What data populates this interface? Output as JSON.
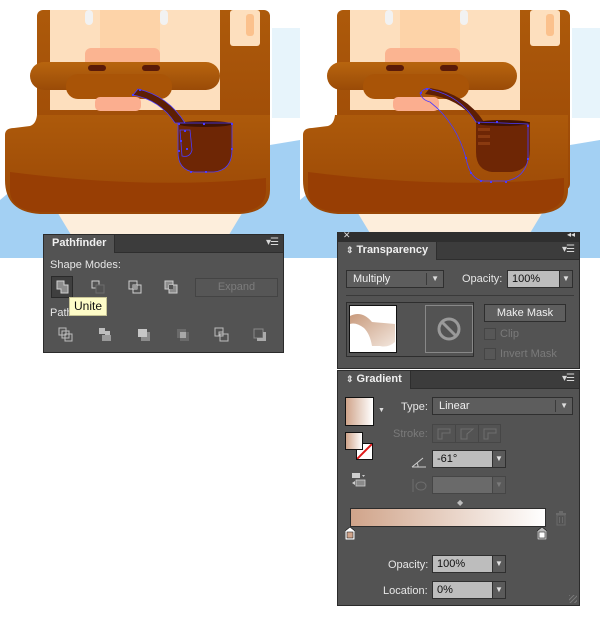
{
  "artwork": {
    "left": {
      "state": "before",
      "description": "pipe selected with anchor points",
      "colors": {
        "beard": "#a65107",
        "beard_dark": "#8c3f05",
        "skin": "#fde0bf",
        "nose": "#fbb08d",
        "pipe": "#6a2204",
        "selection": "#4b3bff",
        "sky": "#a9d3f3"
      }
    },
    "right": {
      "state": "after",
      "description": "pipe with unified shadow path selected"
    }
  },
  "pathfinder": {
    "tab_label": "Pathfinder",
    "menu_icon": "panel-menu-icon",
    "shape_modes_label": "Shape Modes:",
    "shape_modes": [
      {
        "name": "unite",
        "icon": "unite-icon",
        "active": true
      },
      {
        "name": "minus-front",
        "icon": "minus-front-icon"
      },
      {
        "name": "intersect",
        "icon": "intersect-icon"
      },
      {
        "name": "exclude",
        "icon": "exclude-icon"
      }
    ],
    "expand_label": "Expand",
    "pathfinders_label": "Pathfinders:",
    "pathfinders_visible_label": "Path",
    "pathfinders": [
      {
        "name": "divide",
        "icon": "divide-icon"
      },
      {
        "name": "trim",
        "icon": "trim-icon"
      },
      {
        "name": "merge",
        "icon": "merge-icon"
      },
      {
        "name": "crop",
        "icon": "crop-icon"
      },
      {
        "name": "outline",
        "icon": "outline-icon"
      },
      {
        "name": "minus-back",
        "icon": "minus-back-icon"
      }
    ],
    "tooltip": "Unite"
  },
  "transparency": {
    "close_icon": "close-icon",
    "collapse_icon": "collapse-icon",
    "tab_label": "Transparency",
    "blend_mode": "Multiply",
    "opacity_label": "Opacity:",
    "opacity_value": "100%",
    "make_mask_label": "Make Mask",
    "clip_label": "Clip",
    "invert_mask_label": "Invert Mask"
  },
  "gradient": {
    "tab_label": "Gradient",
    "type_label": "Type:",
    "type_value": "Linear",
    "stroke_label": "Stroke:",
    "angle_value": "-61°",
    "aspect_value": "",
    "opacity_label": "Opacity:",
    "opacity_value": "100%",
    "location_label": "Location:",
    "location_value": "0%",
    "stops": [
      {
        "color": "#d0a48a",
        "location": 0
      },
      {
        "color": "#ffffff",
        "location": 100
      }
    ],
    "midpoint": 50
  }
}
